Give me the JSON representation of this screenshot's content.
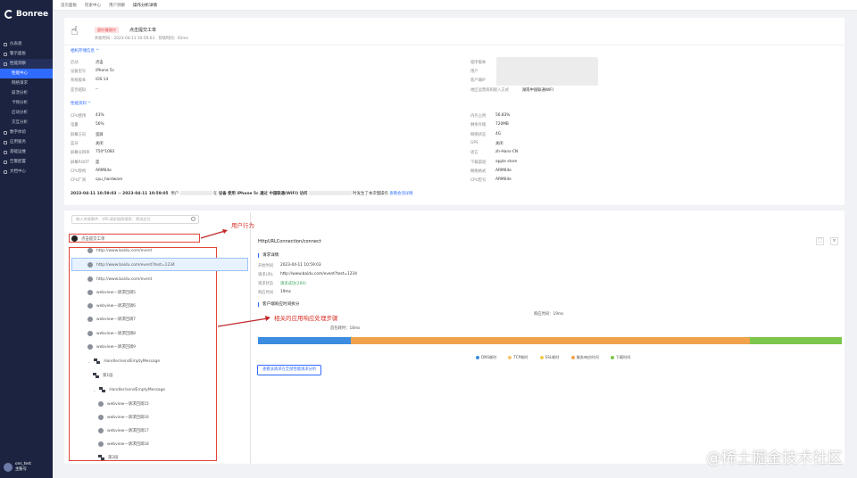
{
  "sidebar": {
    "logo": "Bonree",
    "items": [
      {
        "label": "仪表盘",
        "active": false
      },
      {
        "label": "警示面板",
        "active": false
      },
      {
        "label": "性能洞察",
        "active": true
      }
    ],
    "sub": [
      {
        "label": "性能中心",
        "active": true
      },
      {
        "label": "网络请求",
        "active": false
      },
      {
        "label": "崩溃分析",
        "active": false
      },
      {
        "label": "卡顿分析",
        "active": false
      },
      {
        "label": "启动分析",
        "active": false
      },
      {
        "label": "交互分析",
        "active": false
      }
    ],
    "items2": [
      "数字体验",
      "应用服务",
      "基础运维",
      "告警配置",
      "文档中心"
    ],
    "user": {
      "name": "ons_test",
      "role": "主账号"
    }
  },
  "topnav": [
    "首页面板",
    "检索中心",
    "用户洞察",
    "操作分析详情"
  ],
  "header": {
    "badge": "超时慢操作",
    "title": "点击提交工单",
    "meta": "开始时间：2023-04-11 10:59:03　持续时间：92ms"
  },
  "sec1": {
    "title": "相机存储信息 ^",
    "rows": [
      [
        "启动",
        "点击"
      ],
      [
        "设备型号",
        "iPhone 5c"
      ],
      [
        "系统版本",
        "iOS 14"
      ],
      [
        "是否越狱",
        "--"
      ]
    ],
    "right": [
      [
        "程序版本",
        ""
      ],
      [
        "用户",
        ""
      ],
      [
        "客户端IP",
        ""
      ],
      [
        "地区运营商和接入方式",
        "湖南中国联通WIFI"
      ]
    ]
  },
  "sec2": {
    "title": "性能资料 ^",
    "left": [
      [
        "CPU使用",
        "43%"
      ],
      [
        "电量",
        "56%"
      ],
      [
        "屏幕方向",
        "竖屏"
      ],
      [
        "蓝牙",
        "关闭"
      ],
      [
        "屏幕分辨率",
        "750*1083"
      ],
      [
        "屏幕ROOT",
        "是"
      ],
      [
        "CPU架构",
        "ARM64e"
      ],
      [
        "CPU厂商",
        "cpu_hardware"
      ]
    ],
    "right": [
      [
        "内存占用",
        "56.83%"
      ],
      [
        "剩余存储",
        "720MB"
      ],
      [
        "网络状态",
        "4G"
      ],
      [
        "GPS",
        "关闭"
      ],
      [
        "语言",
        "zh-Hans-CN"
      ],
      [
        "下载渠道",
        "apple store"
      ],
      [
        "网络格式",
        "ARM64e"
      ],
      [
        "CPU型号",
        "ARM64e"
      ]
    ]
  },
  "summary": {
    "time": "2023-04-11 10:59:03 -- 2023-04-11 10:59:05",
    "user": "用户",
    "in": "在",
    "device": "设备 使用 iPhone 5c 通过 中国联通(WIFI) 访问",
    "op": "时发生了本次慢操作",
    "link": "查看会话详情"
  },
  "search": {
    "placeholder": "输入关键事件、URL请求链接搜索、筛选定位"
  },
  "tree": {
    "root": "点击提交工单",
    "items": [
      "http://www.baidu.com/event",
      "http://www.baidu.com/event?test=1234",
      "http://www.baidu.com/event",
      "webview—请求回调5",
      "webview—请求回调6",
      "webview—请求回调7",
      "webview—请求回调8",
      "webview—请求回调9",
      "Handler/sendEmptyMessage",
      "第1层",
      "Handler/sendEmptyMessage",
      "webview—请求回调15",
      "webview—请求回调16",
      "webview—请求回调17",
      "webview—请求回调18",
      "第2层"
    ]
  },
  "annot": {
    "user": "用户行为",
    "steps": "相关的应用响应处理步骤"
  },
  "detail": {
    "title": "HttpURLConnection/connect",
    "sec1": "请求详情",
    "rows": [
      [
        "开始时间",
        "2023-04-11 10:59:03"
      ],
      [
        "请求URL",
        "http://www.baidu.com/event?test=1234"
      ],
      [
        "请求状态",
        "请求成功(200)"
      ],
      [
        "响应时间",
        "19ms"
      ]
    ],
    "sec2": "客户端响应时间拆分",
    "resp": "响应时间：19ms",
    "wait": "首包耗时：18ms",
    "legend": [
      "DNS耗时",
      "TCP耗时",
      "SSL耗时",
      "服务响应时间",
      "下载时间"
    ],
    "button": "查看该请求在全部性能请求分析"
  },
  "colors": {
    "dns": "#3c8cdf",
    "tcp": "#f0a24c",
    "ssl": "#f0a24c",
    "server": "#f0a24c",
    "download": "#7cc74b",
    "accent": "#2f6bff"
  },
  "watermark": "@稀土掘金技术社区"
}
